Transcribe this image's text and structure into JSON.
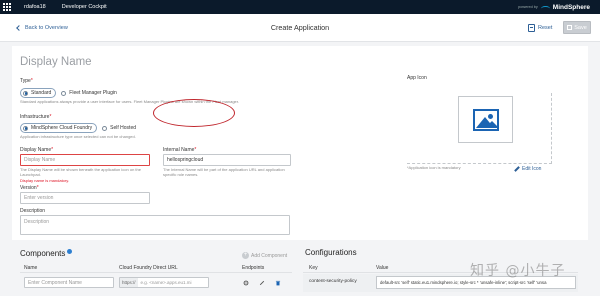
{
  "topbar": {
    "tenant": "rdafoa18",
    "app": "Developer Cockpit",
    "powered_by": "powered by",
    "brand": "MindSphere"
  },
  "header": {
    "back_label": "Back to Overview",
    "title": "Create Application",
    "reset_label": "Reset",
    "save_label": "Save"
  },
  "form": {
    "display_name_heading": "Display Name",
    "type": {
      "label": "Type",
      "options": [
        "Standard",
        "Fleet Manager Plugin"
      ],
      "selected": "Standard",
      "help": "Standard applications always provide a user interface for users. Fleet Manager Plugins are shown within the Fleet manager."
    },
    "infrastructure": {
      "label": "Infrastructure",
      "options": [
        "MindSphere Cloud Foundry",
        "Self Hosted"
      ],
      "selected": "MindSphere Cloud Foundry",
      "help": "Application infrastructure type once selected can not be changed."
    },
    "display_name": {
      "label": "Display Name",
      "placeholder": "Display Name",
      "help": "The Display Name will be shown beneath the application icon on the Launchpad.",
      "error": "Display name is mandatory."
    },
    "internal_name": {
      "label": "Internal Name",
      "value": "hellospringcloud",
      "help": "The Internal Name will be part of the application URL and application specific role names."
    },
    "version": {
      "label": "Version",
      "placeholder": "Enter version"
    },
    "description": {
      "label": "Description",
      "placeholder": "Description"
    }
  },
  "app_icon": {
    "label": "App Icon",
    "note": "*Application icon is mandatory",
    "edit_label": "Edit Icon"
  },
  "components": {
    "title": "Components",
    "add_label": "Add Component",
    "columns": [
      "Name",
      "Cloud Foundry Direct URL",
      "Endpoints"
    ],
    "row": {
      "name_placeholder": "Enter Component Name",
      "url_prefix": "https://",
      "url_placeholder": "e.g. <name>.apps.eu1.mi"
    }
  },
  "configurations": {
    "title": "Configurations",
    "columns": [
      "Key",
      "Value"
    ],
    "rows": [
      {
        "key": "content-security-policy",
        "value": "default-src 'self' static.eu1.mindsphere.io; style-src * 'unsafe-inline'; script-src 'self' 'unsa"
      }
    ]
  },
  "watermark": "知乎 @小牛子",
  "colors": {
    "topbar_bg": "#0b1a2b",
    "link": "#2d5f96",
    "error": "#d12",
    "annotation": "#c0262d"
  }
}
